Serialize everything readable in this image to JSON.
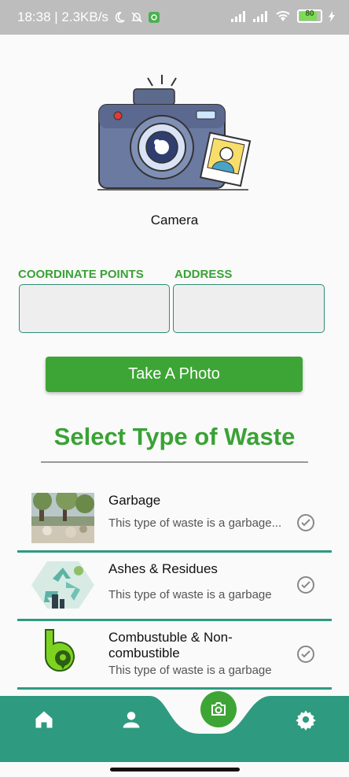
{
  "status_bar": {
    "time_speed": "18:38 | 2.3KB/s",
    "battery": "80"
  },
  "camera": {
    "label": "Camera"
  },
  "fields": {
    "coordinate_label": "COORDINATE POINTS",
    "address_label": "ADDRESS"
  },
  "take_photo": {
    "label": "Take A Photo"
  },
  "section": {
    "title": "Select Type of Waste"
  },
  "waste_types": [
    {
      "title": "Garbage",
      "description": "This type of waste is a garbage..."
    },
    {
      "title": "Ashes & Residues",
      "description": "This type of waste is a garbage"
    },
    {
      "title": "Combustuble & Non-combustible",
      "description": "This type of waste is a garbage"
    }
  ],
  "nav": {
    "items": [
      "home-icon",
      "person-icon",
      "camera-icon",
      "settings-icon"
    ]
  },
  "colors": {
    "accent_green": "#3da535",
    "teal": "#2e9a80"
  }
}
